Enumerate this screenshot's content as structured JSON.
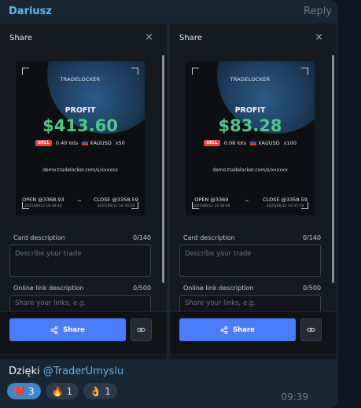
{
  "message": {
    "author": "Dariusz",
    "reply_label": "Reply",
    "caption_text": "Dzięki ",
    "mention": "@TraderUmyslu",
    "time": "09:39",
    "reactions": [
      {
        "emoji": "❤️",
        "count": "3",
        "mine": true
      },
      {
        "emoji": "🔥",
        "count": "1",
        "mine": false
      },
      {
        "emoji": "👌",
        "count": "1",
        "mine": false
      }
    ]
  },
  "shares": [
    {
      "title": "Share",
      "close": "×",
      "brand": "TRADELOCKER",
      "profit_label": "PROFIT",
      "profit_value": "$413.60",
      "side": "SELL",
      "lots": "0.40 lots",
      "symbol": "XAUUSD",
      "leverage": "x50",
      "link": "demo.tradelocker.com/s/xxxxxx",
      "open": "OPEN @3368.93",
      "open_date": "2025/06/12 10:30:48",
      "close_label": "CLOSE @3358.59",
      "close_date": "2025/06/12 10:35:59",
      "card_desc_label": "Card description",
      "card_desc_count": "0/140",
      "card_desc_placeholder": "Describe your trade",
      "online_link_label": "Online link description",
      "online_link_count": "0/500",
      "online_link_placeholder": "Share your links, e.g.",
      "share_button": "Share"
    },
    {
      "title": "Share",
      "close": "×",
      "brand": "TRADELOCKER",
      "profit_label": "PROFIT",
      "profit_value": "$83.28",
      "side": "SELL",
      "lots": "0.08 lots",
      "symbol": "XAUUSD",
      "leverage": "x100",
      "link": "demo.tradelocker.com/s/xxxxxx",
      "open": "OPEN @3369",
      "open_date": "2025/06/12 10:30:46",
      "close_label": "CLOSE @3358.59",
      "close_date": "2025/06/12 10:35:59",
      "card_desc_label": "Card description",
      "card_desc_count": "0/140",
      "card_desc_placeholder": "Describe your trade",
      "online_link_label": "Online link description",
      "online_link_count": "0/500",
      "online_link_placeholder": "Share your links, e.g.",
      "share_button": "Share"
    }
  ],
  "colors": {
    "profit": "#4ec98a",
    "accent": "#4a7cff",
    "sell": "#e5484d",
    "author": "#64b5ef"
  }
}
